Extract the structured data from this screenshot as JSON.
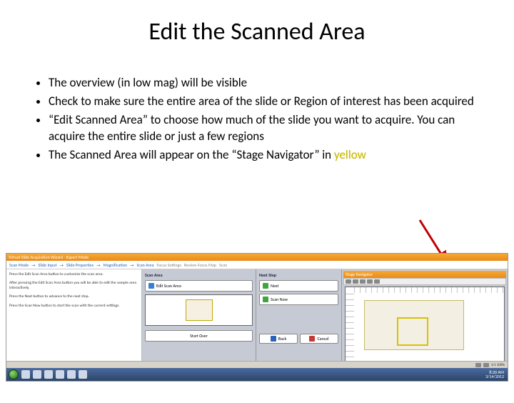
{
  "title": "Edit the Scanned Area",
  "bullets": {
    "b1": "The overview (in low mag) will be visible",
    "b2": "Check to make sure the entire area of the slide or Region of interest has been acquired",
    "b3": "“Edit Scanned Area” to choose how much of the slide you want to acquire. You can acquire the entire slide or just a few regions",
    "b4_prefix": "The Scanned Area will appear on the “Stage Navigator” in ",
    "b4_yellow": "yellow"
  },
  "wizard": {
    "titlebar": "Virtual Slide Acquisition Wizard - Expert Mode",
    "steps": {
      "s1": "Scan Mode",
      "s2": "Slide Input",
      "s3": "Slide Properties",
      "s4": "Magnification",
      "s5": "Scan Area"
    },
    "tabs": {
      "t1": "Focus Settings",
      "t2": "Review Focus Map",
      "t3": "Scan"
    },
    "left": {
      "p1": "Press the Edit Scan Area button to customize the scan area.",
      "p2": "After pressing the Edit Scan Area button you will be able to edit the sample area interactively.",
      "p3": "Press the Next button to advance to the next step.",
      "p4": "Press the Scan Now button to start the scan with the current settings."
    },
    "scanAreaLabel": "Scan Area",
    "editBtn": "Edit Scan Area",
    "nextStepLabel": "Next Step",
    "nextBtn": "Next",
    "scanNowBtn": "Scan Now",
    "backBtn": "Back",
    "cancelBtn": "Cancel",
    "startOverBtn": "Start Over"
  },
  "stage": {
    "title": "Stage Navigator"
  },
  "lower": {
    "status": "1/1 100%"
  },
  "taskbar": {
    "time": "8:20 AM",
    "date": "3/14/2012"
  }
}
